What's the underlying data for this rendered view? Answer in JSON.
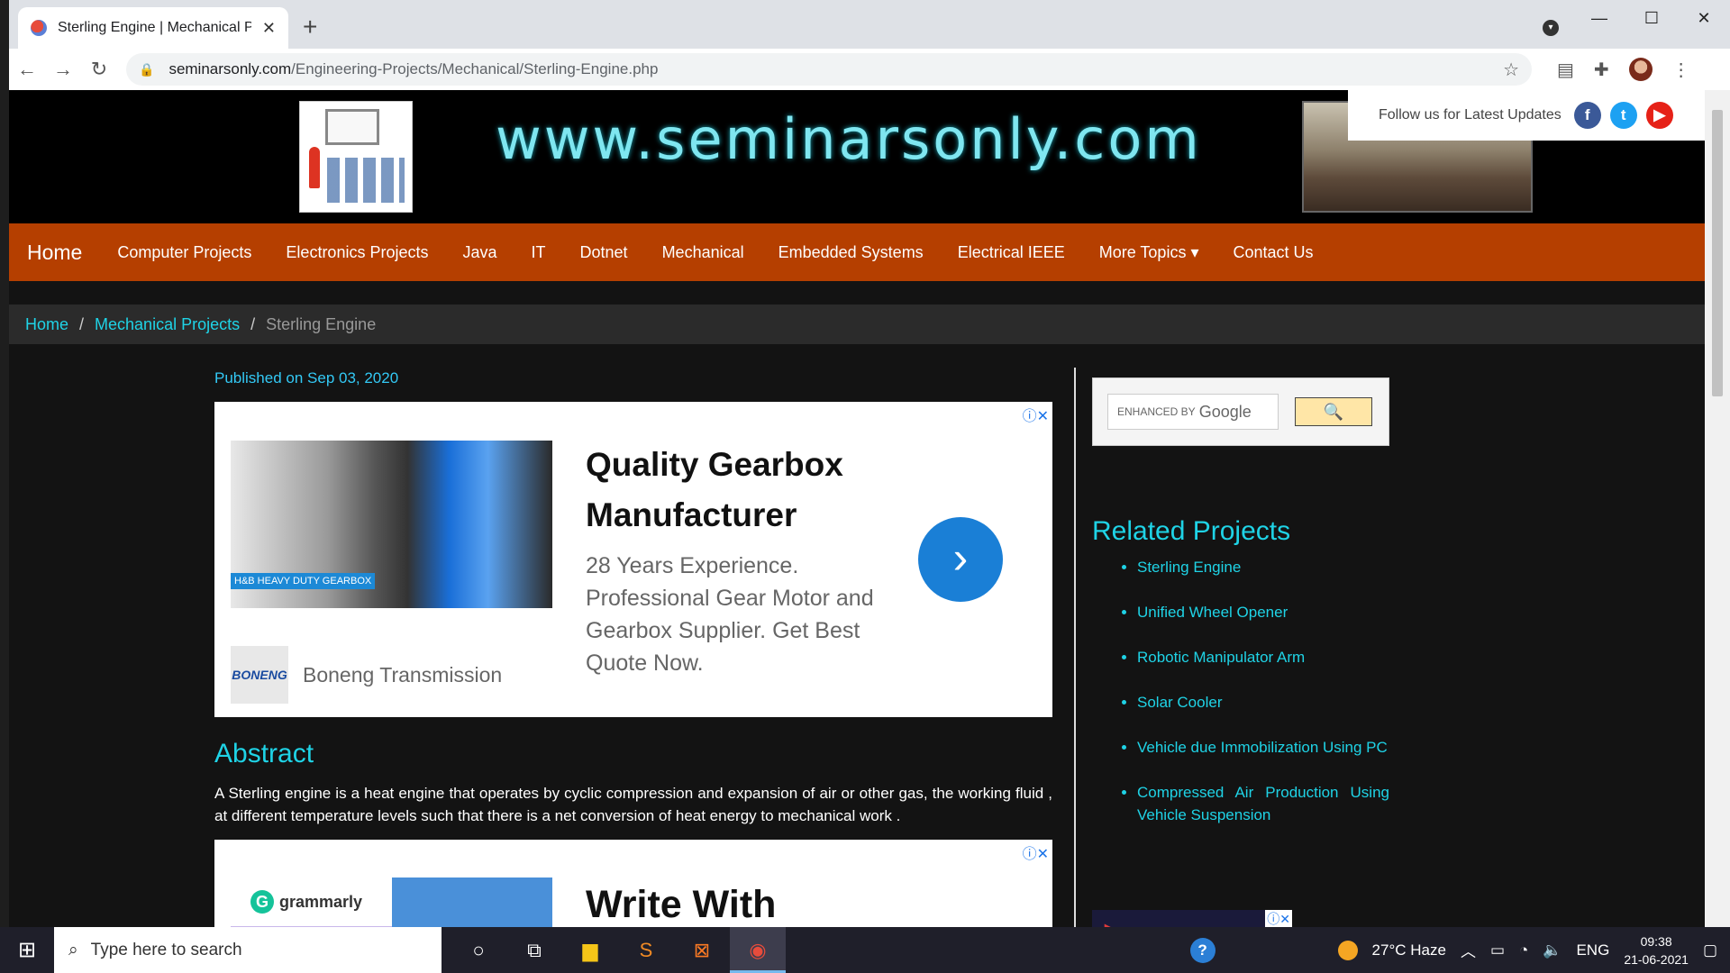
{
  "browser": {
    "tab_title": "Sterling Engine | Mechanical Proj",
    "url_host": "seminarsonly.com",
    "url_path": "/Engineering-Projects/Mechanical/Sterling-Engine.php"
  },
  "header": {
    "site_title": "www.seminarsonly.com",
    "follow_text": "Follow us for Latest Updates",
    "social": [
      "f",
      "t",
      "▶"
    ]
  },
  "nav": {
    "brand": "Home",
    "items": [
      "Computer Projects",
      "Electronics Projects",
      "Java",
      "IT",
      "Dotnet",
      "Mechanical",
      "Embedded Systems",
      "Electrical IEEE",
      "More Topics ▾",
      "Contact Us"
    ]
  },
  "breadcrumb": {
    "home": "Home",
    "section": "Mechanical Projects",
    "current": "Sterling Engine",
    "sep": "/"
  },
  "main": {
    "published": "Published on Sep 03, 2020",
    "ad1": {
      "image_tag": "H&B HEAVY DUTY GEARBOX",
      "title": "Quality Gearbox Manufacturer",
      "text": "28 Years Experience. Professional Gear Motor and Gearbox Supplier. Get Best Quote Now.",
      "brand_logo": "BONENG",
      "brand": "Boneng Transmission"
    },
    "abstract_heading": "Abstract",
    "abstract_text": "A Sterling engine is a heat engine that operates by cyclic compression and expansion of air or other gas, the working fluid , at different temperature levels such that there is a net conversion of heat energy to mechanical work .",
    "ad2": {
      "brand": "grammarly",
      "title": "Write With"
    }
  },
  "sidebar": {
    "search_prefix": "ENHANCED BY",
    "search_brand": "Google",
    "related_heading": "Related Projects",
    "related": [
      "Sterling Engine",
      "Unified Wheel Opener",
      "Robotic Manipulator Arm",
      "Solar Cooler",
      "Vehicle due Immobilization Using PC",
      "Compressed Air Production Using Vehicle Suspension"
    ]
  },
  "taskbar": {
    "search_placeholder": "Type here to search",
    "weather": "27°C  Haze",
    "lang": "ENG",
    "time": "09:38",
    "date": "21-06-2021"
  }
}
